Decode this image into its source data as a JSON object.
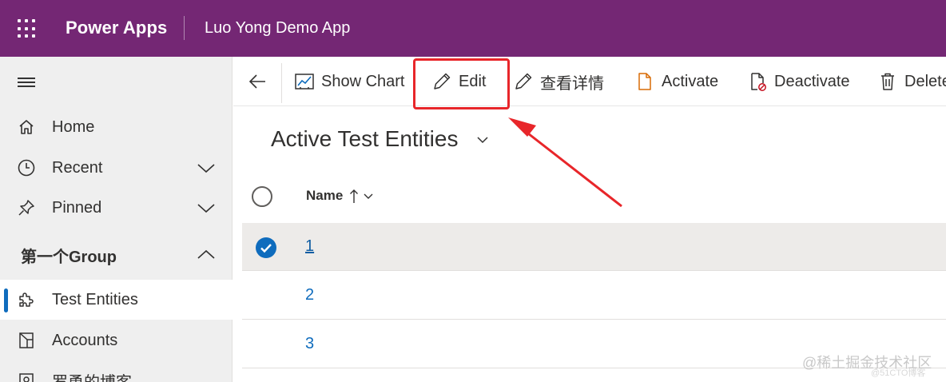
{
  "header": {
    "brand": "Power Apps",
    "app_name": "Luo Yong Demo App",
    "background": "#742774"
  },
  "sidebar": {
    "items": [
      {
        "label": "Home",
        "icon": "home-icon"
      },
      {
        "label": "Recent",
        "icon": "clock-icon",
        "expandable": true
      },
      {
        "label": "Pinned",
        "icon": "pin-icon",
        "expandable": true
      }
    ],
    "group": {
      "label": "第一个Group",
      "expanded": true,
      "items": [
        {
          "label": "Test Entities",
          "icon": "puzzle-icon",
          "selected": true
        },
        {
          "label": "Accounts",
          "icon": "accounts-icon"
        },
        {
          "label": "罗勇的博客",
          "icon": "blog-icon"
        }
      ]
    },
    "accent": "#0f6cbd"
  },
  "commandbar": {
    "commands": [
      {
        "label": "Show Chart",
        "icon": "chart-icon"
      },
      {
        "label": "Edit",
        "icon": "pencil-icon"
      },
      {
        "label": "查看详情",
        "icon": "pencil-icon"
      },
      {
        "label": "Activate",
        "icon": "document-icon"
      },
      {
        "label": "Deactivate",
        "icon": "document-block-icon"
      },
      {
        "label": "Delete",
        "icon": "trash-icon"
      }
    ],
    "highlighted": "Edit",
    "highlight_color": "#e8262a"
  },
  "view": {
    "title": "Active Test Entities",
    "column": {
      "label": "Name",
      "sort": "ascending"
    },
    "rows": [
      {
        "name": "1",
        "selected": true
      },
      {
        "name": "2",
        "selected": false
      },
      {
        "name": "3",
        "selected": false
      }
    ]
  },
  "watermark": {
    "line1": "@稀土掘金技术社区",
    "line2": "@51CTO博客"
  }
}
